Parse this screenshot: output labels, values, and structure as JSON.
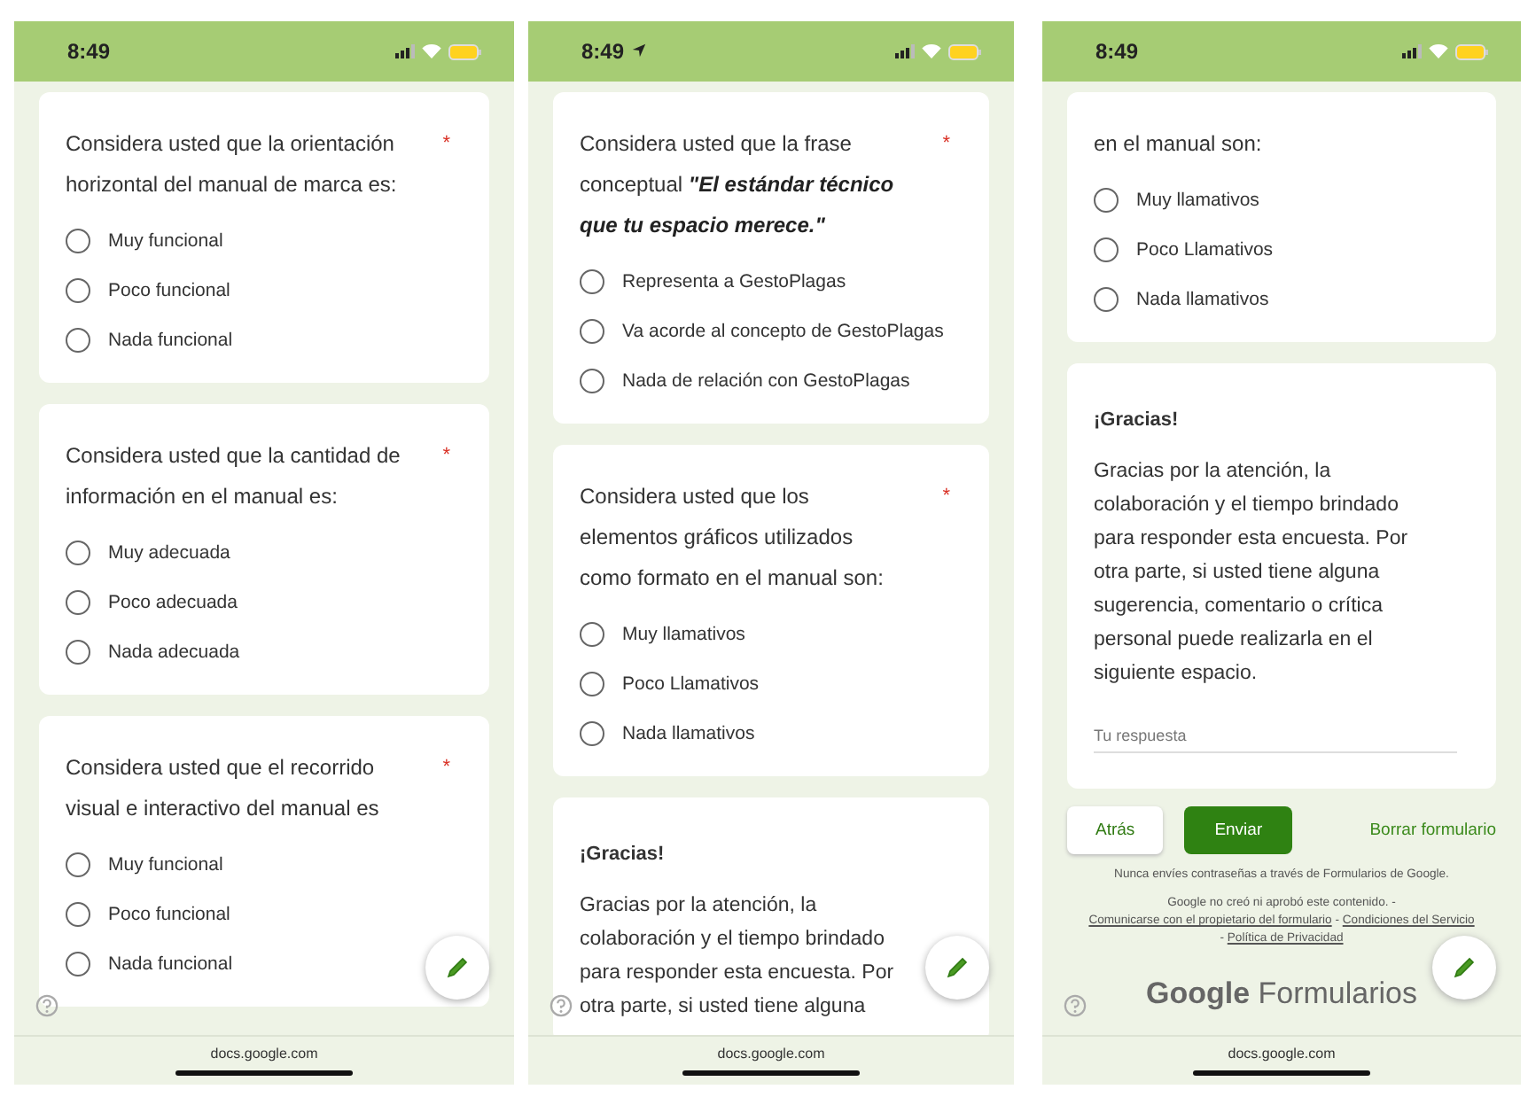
{
  "phones": [
    {
      "status_bar": {
        "time": "8:49",
        "location": false
      },
      "cards": [
        {
          "kind": "question",
          "question": "Considera usted que la orientación horizontal del manual de marca es:",
          "required_mark": "*",
          "options": [
            {
              "label": "Muy funcional",
              "selected": false
            },
            {
              "label": "Poco funcional",
              "selected": false
            },
            {
              "label": "Nada funcional",
              "selected": false
            }
          ]
        },
        {
          "kind": "question",
          "question": "Considera usted que la cantidad de información en el manual es:",
          "required_mark": "*",
          "options": [
            {
              "label": "Muy adecuada",
              "selected": false
            },
            {
              "label": "Poco adecuada",
              "selected": false
            },
            {
              "label": "Nada adecuada",
              "selected": false
            }
          ]
        },
        {
          "kind": "question",
          "question": "Considera usted que el recorrido visual e interactivo del manual es",
          "required_mark": "*",
          "options": [
            {
              "label": "Muy funcional",
              "selected": false
            },
            {
              "label": "Poco funcional",
              "selected": false
            },
            {
              "label": "Nada funcional",
              "selected": false
            }
          ]
        }
      ],
      "url": "docs.google.com"
    },
    {
      "status_bar": {
        "time": "8:49",
        "location": true
      },
      "cards": [
        {
          "kind": "question",
          "question": "Considera usted que la frase conceptual **\"El estándar técnico que tu espacio merece.\"**",
          "required_mark": "*",
          "options": [
            {
              "label": "Representa a GestoPlagas",
              "selected": false
            },
            {
              "label": "Va acorde al concepto de GestoPlagas",
              "selected": false
            },
            {
              "label": "Nada de relación con GestoPlagas",
              "selected": false
            }
          ]
        },
        {
          "kind": "question",
          "question": "Considera usted que los elementos gráficos utilizados como formato en el manual son:",
          "required_mark": "*",
          "options": [
            {
              "label": "Muy llamativos",
              "selected": false
            },
            {
              "label": "Poco Llamativos",
              "selected": false
            },
            {
              "label": "Nada llamativos",
              "selected": false
            }
          ]
        },
        {
          "kind": "section",
          "title": "¡Gracias!",
          "text": "Gracias por la atención, la colaboración y el tiempo brindado para responder esta encuesta. Por otra parte, si usted tiene alguna"
        }
      ],
      "url": "docs.google.com"
    },
    {
      "status_bar": {
        "time": "8:49",
        "location": false
      },
      "cards": [
        {
          "kind": "question",
          "question": "en el manual son:",
          "options": [
            {
              "label": "Muy llamativos",
              "selected": false
            },
            {
              "label": "Poco Llamativos",
              "selected": false
            },
            {
              "label": "Nada llamativos",
              "selected": false
            }
          ]
        },
        {
          "kind": "section",
          "title": "¡Gracias!",
          "text": "Gracias por la atención, la colaboración y el tiempo brindado para responder esta encuesta. Por otra parte, si usted tiene alguna sugerencia, comentario o crítica personal puede realizarla en el siguiente espacio.",
          "answer": {
            "placeholder": "Tu respuesta"
          }
        }
      ],
      "form_footer": {
        "back": "Atrás",
        "submit": "Enviar",
        "clear": "Borrar formulario",
        "notice": "Nunca envíes contraseñas a través de Formularios de Google.",
        "disclaimer": [
          {
            "kind": "text",
            "text": "Google no creó ni aprobó este contenido. -"
          },
          {
            "kind": "link",
            "text": "Comunicarse con el propietario del formulario"
          },
          {
            "kind": "text",
            "text": "-"
          },
          {
            "kind": "link",
            "text": "Condiciones del Servicio"
          },
          {
            "kind": "text",
            "text": "-"
          },
          {
            "kind": "link",
            "text": "Política de Privacidad"
          }
        ],
        "brand": "**Google** Formularios"
      },
      "url": "docs.google.com"
    }
  ]
}
